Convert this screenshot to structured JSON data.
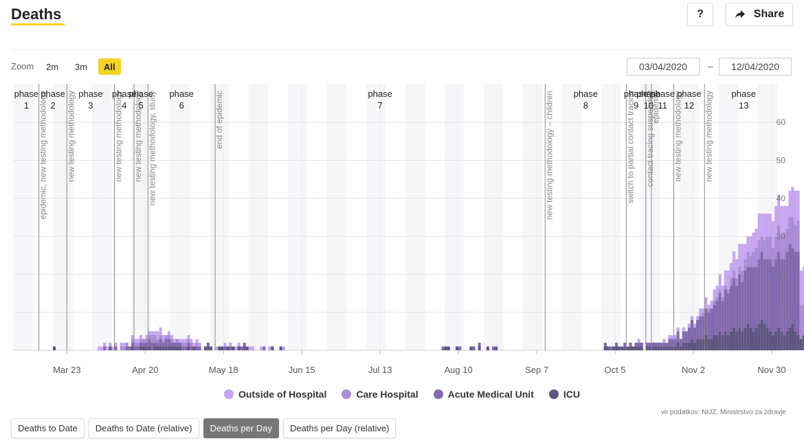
{
  "header": {
    "title": "Deaths",
    "help_label": "?",
    "share_label": "Share"
  },
  "zoom": {
    "label": "Zoom",
    "options": [
      "2m",
      "3m",
      "All"
    ],
    "active": "All"
  },
  "date_range": {
    "from": "03/04/2020",
    "separator": "–",
    "to": "12/04/2020"
  },
  "legend": [
    {
      "label": "Outside of Hospital",
      "color": "#c7a6f0"
    },
    {
      "label": "Care Hospital",
      "color": "#a98bd6"
    },
    {
      "label": "Acute Medical Unit",
      "color": "#8269ad"
    },
    {
      "label": "ICU",
      "color": "#5f5680"
    }
  ],
  "credits": "vir podatkov: NIJZ, Ministrstvo za zdravje",
  "tabs": [
    "Deaths to Date",
    "Deaths to Date (relative)",
    "Deaths per Day",
    "Deaths per Day (relative)"
  ],
  "active_tab": "Deaths per Day",
  "chart_data": {
    "type": "bar",
    "stacked": true,
    "x_start": "2020-03-04",
    "x_end": "2020-12-04",
    "x_ticks": [
      {
        "date": "2020-03-23",
        "label": "Mar 23"
      },
      {
        "date": "2020-04-20",
        "label": "Apr 20"
      },
      {
        "date": "2020-05-18",
        "label": "May 18"
      },
      {
        "date": "2020-06-15",
        "label": "Jun 15"
      },
      {
        "date": "2020-07-13",
        "label": "Jul 13"
      },
      {
        "date": "2020-08-10",
        "label": "Aug 10"
      },
      {
        "date": "2020-09-07",
        "label": "Sep 7"
      },
      {
        "date": "2020-10-05",
        "label": "Oct 5"
      },
      {
        "date": "2020-11-02",
        "label": "Nov 2"
      },
      {
        "date": "2020-11-30",
        "label": "Nov 30"
      }
    ],
    "y_ticks": [
      10,
      20,
      30,
      40,
      50,
      60
    ],
    "ylim": [
      0,
      62
    ],
    "grid": true,
    "phases": [
      {
        "line1": "phase",
        "line2": "1",
        "start": "2020-03-04",
        "end": "2020-03-13"
      },
      {
        "line1": "phase",
        "line2": "2",
        "start": "2020-03-13",
        "end": "2020-03-23"
      },
      {
        "line1": "phase",
        "line2": "3",
        "start": "2020-03-23",
        "end": "2020-04-09"
      },
      {
        "line1": "phase",
        "line2": "4",
        "start": "2020-04-09",
        "end": "2020-04-16"
      },
      {
        "line1": "phase",
        "line2": "5",
        "start": "2020-04-16",
        "end": "2020-04-21"
      },
      {
        "line1": "phase",
        "line2": "6",
        "start": "2020-04-21",
        "end": "2020-05-15"
      },
      {
        "line1": "phase",
        "line2": "7",
        "start": "2020-05-15",
        "end": "2020-09-10"
      },
      {
        "line1": "phase",
        "line2": "8",
        "start": "2020-09-10",
        "end": "2020-10-09"
      },
      {
        "line1": "phase",
        "line2": "9",
        "start": "2020-10-09",
        "end": "2020-10-16"
      },
      {
        "line1": "phase",
        "line2": "10",
        "start": "2020-10-16",
        "end": "2020-10-18"
      },
      {
        "line1": "phase",
        "line2": "11",
        "start": "2020-10-18",
        "end": "2020-10-26"
      },
      {
        "line1": "phase",
        "line2": "12",
        "start": "2020-10-26",
        "end": "2020-11-06"
      },
      {
        "line1": "phase",
        "line2": "13",
        "start": "2020-11-06",
        "end": "2020-12-04"
      }
    ],
    "events": [
      {
        "date": "2020-03-13",
        "label": "epidemic, new testing methodology"
      },
      {
        "date": "2020-03-23",
        "label": "new testing methodology"
      },
      {
        "date": "2020-04-09",
        "label": "new testing methodology"
      },
      {
        "date": "2020-04-16",
        "label": "new testing methodology"
      },
      {
        "date": "2020-04-21",
        "label": "new testing methodology, study"
      },
      {
        "date": "2020-05-15",
        "label": "end of epidemic"
      },
      {
        "date": "2020-09-10",
        "label": "new testing methodology – children"
      },
      {
        "date": "2020-10-09",
        "label": "switch to partial contact tracing"
      },
      {
        "date": "2020-10-16",
        "label": "contact tracing suspended"
      },
      {
        "date": "2020-10-18",
        "label": "epidemic"
      },
      {
        "date": "2020-10-26",
        "label": "new testing methodology"
      },
      {
        "date": "2020-11-06",
        "label": "new testing methodology"
      }
    ],
    "series": [
      {
        "name": "Outside of Hospital",
        "values": [
          0,
          0,
          0,
          0,
          0,
          0,
          0,
          0,
          0,
          0,
          0,
          0,
          0,
          0,
          0,
          0,
          0,
          0,
          0,
          0,
          0,
          0,
          0,
          0,
          0,
          0,
          0,
          0,
          0,
          0,
          1,
          1,
          1,
          1,
          1,
          1,
          1,
          0,
          1,
          1,
          0,
          0,
          1,
          1,
          1,
          1,
          0,
          1,
          1,
          1,
          1,
          2,
          2,
          1,
          0,
          1,
          1,
          1,
          0,
          1,
          1,
          1,
          1,
          1,
          1,
          1,
          1,
          0,
          0,
          0,
          0,
          0,
          1,
          0,
          0,
          1,
          0,
          1,
          0,
          1,
          1,
          0,
          0,
          0,
          1,
          1,
          0,
          0,
          1,
          0,
          0,
          1,
          0,
          0,
          0,
          0,
          1,
          0,
          0,
          0,
          0,
          0,
          0,
          0,
          0,
          0,
          0,
          0,
          0,
          0,
          0,
          0,
          0,
          0,
          0,
          0,
          0,
          0,
          0,
          0,
          0,
          0,
          0,
          0,
          0,
          0,
          0,
          0,
          0,
          0,
          0,
          0,
          0,
          0,
          0,
          0,
          0,
          0,
          0,
          0,
          0,
          0,
          0,
          0,
          0,
          0,
          0,
          0,
          0,
          0,
          0,
          0,
          0,
          0,
          0,
          0,
          0,
          0,
          0,
          0,
          0,
          0,
          0,
          0,
          0,
          0,
          0,
          0,
          0,
          0,
          0,
          0,
          0,
          0,
          0,
          0,
          0,
          0,
          0,
          0,
          0,
          0,
          0,
          0,
          0,
          0,
          0,
          0,
          0,
          0,
          0,
          0,
          0,
          0,
          0,
          0,
          0,
          0,
          0,
          0,
          0,
          0,
          0,
          0,
          0,
          0,
          0,
          0,
          0,
          0,
          0,
          0,
          0,
          0,
          0,
          0,
          0,
          0,
          0,
          0,
          0,
          0,
          0,
          1,
          0,
          0,
          0,
          0,
          0,
          0,
          0,
          0,
          1,
          0,
          1,
          1,
          1,
          1,
          0,
          1,
          0,
          1,
          1,
          1,
          1,
          2,
          1,
          3,
          1,
          2,
          3,
          3,
          4,
          3,
          4,
          5,
          4,
          5,
          5,
          6,
          7,
          4,
          4,
          5,
          5,
          5,
          7,
          6,
          7,
          6,
          6,
          7,
          8,
          8,
          8,
          7,
          6,
          7,
          8,
          9,
          8,
          9,
          10,
          11,
          9,
          10,
          8,
          9,
          10,
          11,
          12
        ]
      },
      {
        "name": "Care Hospital",
        "values": [
          0,
          0,
          0,
          0,
          0,
          0,
          0,
          0,
          0,
          0,
          0,
          0,
          0,
          0,
          0,
          0,
          0,
          0,
          0,
          0,
          0,
          0,
          0,
          0,
          0,
          0,
          0,
          0,
          0,
          0,
          0,
          0,
          0,
          0,
          0,
          0,
          0,
          0,
          1,
          1,
          1,
          0,
          1,
          1,
          1,
          1,
          1,
          1,
          1,
          2,
          2,
          1,
          1,
          1,
          1,
          1,
          1,
          0,
          1,
          0,
          1,
          1,
          1,
          1,
          0,
          1,
          0,
          0,
          0,
          0,
          0,
          0,
          0,
          0,
          0,
          0,
          0,
          0,
          0,
          0,
          0,
          0,
          0,
          0,
          0,
          0,
          0,
          0,
          0,
          0,
          0,
          0,
          0,
          0,
          0,
          0,
          0,
          0,
          0,
          0,
          0,
          0,
          0,
          0,
          0,
          0,
          0,
          0,
          0,
          0,
          0,
          0,
          0,
          0,
          0,
          0,
          0,
          0,
          0,
          0,
          0,
          0,
          0,
          0,
          0,
          0,
          0,
          0,
          0,
          0,
          0,
          0,
          0,
          0,
          0,
          0,
          0,
          0,
          0,
          0,
          0,
          0,
          0,
          0,
          0,
          0,
          0,
          0,
          0,
          0,
          0,
          0,
          0,
          0,
          0,
          0,
          0,
          0,
          0,
          0,
          0,
          0,
          0,
          0,
          0,
          0,
          0,
          0,
          0,
          0,
          0,
          0,
          0,
          0,
          0,
          0,
          0,
          0,
          0,
          0,
          0,
          0,
          0,
          0,
          0,
          0,
          0,
          0,
          0,
          0,
          0,
          0,
          0,
          0,
          0,
          0,
          0,
          0,
          0,
          0,
          0,
          0,
          0,
          0,
          0,
          0,
          0,
          0,
          0,
          0,
          0,
          0,
          0,
          0,
          0,
          0,
          0,
          0,
          0,
          0,
          0,
          0,
          0,
          0,
          0,
          0,
          0,
          0,
          0,
          0,
          0,
          0,
          0,
          0,
          0,
          0,
          0,
          0,
          0,
          0,
          0,
          0,
          0,
          0,
          0,
          0,
          1,
          0,
          1,
          0,
          1,
          1,
          1,
          1,
          1,
          1,
          2,
          2,
          2,
          2,
          3,
          3,
          4,
          3,
          4,
          5,
          5,
          4,
          5,
          6,
          6,
          5,
          6,
          7,
          6,
          7,
          6,
          7,
          8,
          7,
          8,
          9,
          8,
          9,
          8,
          9,
          10,
          9,
          10,
          11,
          12,
          10,
          11,
          12
        ]
      },
      {
        "name": "Acute Medical Unit",
        "values": [
          0,
          0,
          0,
          0,
          0,
          0,
          0,
          0,
          0,
          0,
          0,
          0,
          0,
          0,
          0,
          0,
          0,
          0,
          0,
          0,
          0,
          0,
          0,
          0,
          0,
          0,
          0,
          0,
          0,
          0,
          0,
          0,
          1,
          0,
          0,
          0,
          1,
          0,
          0,
          0,
          1,
          1,
          1,
          1,
          1,
          1,
          1,
          1,
          2,
          2,
          1,
          1,
          2,
          1,
          2,
          2,
          1,
          1,
          1,
          1,
          1,
          1,
          1,
          1,
          0,
          1,
          1,
          0,
          0,
          1,
          0,
          0,
          0,
          0,
          0,
          1,
          0,
          1,
          0,
          0,
          0,
          1,
          1,
          0,
          0,
          0,
          0,
          0,
          0,
          1,
          0,
          0,
          0,
          0,
          0,
          0,
          0,
          0,
          0,
          0,
          0,
          0,
          0,
          0,
          0,
          0,
          0,
          0,
          0,
          0,
          0,
          0,
          0,
          0,
          0,
          0,
          0,
          0,
          0,
          0,
          0,
          0,
          0,
          0,
          0,
          0,
          0,
          0,
          0,
          0,
          0,
          0,
          0,
          0,
          0,
          0,
          0,
          0,
          0,
          0,
          0,
          0,
          0,
          0,
          0,
          0,
          0,
          0,
          0,
          0,
          0,
          0,
          0,
          1,
          0,
          0,
          0,
          0,
          0,
          1,
          0,
          0,
          0,
          0,
          1,
          0,
          1,
          0,
          0,
          0,
          0,
          1,
          0,
          0,
          0,
          0,
          0,
          0,
          0,
          0,
          0,
          0,
          0,
          0,
          0,
          0,
          0,
          0,
          0,
          0,
          0,
          0,
          0,
          0,
          0,
          0,
          0,
          0,
          0,
          0,
          0,
          0,
          0,
          0,
          0,
          0,
          0,
          0,
          0,
          0,
          0,
          1,
          0,
          1,
          0,
          1,
          0,
          0,
          1,
          0,
          1,
          0,
          1,
          1,
          1,
          0,
          1,
          1,
          1,
          1,
          1,
          1,
          1,
          1,
          2,
          2,
          2,
          3,
          2,
          3,
          3,
          4,
          5,
          4,
          5,
          6,
          6,
          7,
          7,
          8,
          8,
          9,
          10,
          9,
          11,
          11,
          12,
          13,
          12,
          14,
          13,
          15,
          15,
          16,
          17,
          16,
          17,
          18,
          17,
          18,
          19,
          18,
          19,
          20,
          19,
          20,
          21,
          22,
          20,
          21,
          22
        ]
      },
      {
        "name": "ICU",
        "values": [
          0,
          0,
          0,
          0,
          0,
          0,
          0,
          0,
          0,
          0,
          0,
          0,
          0,
          0,
          1,
          0,
          0,
          0,
          0,
          0,
          0,
          0,
          0,
          0,
          0,
          0,
          0,
          0,
          0,
          0,
          0,
          0,
          0,
          0,
          1,
          0,
          0,
          0,
          0,
          0,
          0,
          0,
          1,
          0,
          0,
          1,
          1,
          1,
          1,
          0,
          1,
          1,
          1,
          1,
          1,
          1,
          1,
          1,
          1,
          1,
          0,
          0,
          1,
          0,
          1,
          0,
          0,
          0,
          1,
          1,
          1,
          0,
          0,
          1,
          1,
          0,
          1,
          0,
          1,
          0,
          1,
          0,
          1,
          1,
          0,
          0,
          0,
          0,
          0,
          0,
          0,
          0,
          1,
          0,
          0,
          1,
          0,
          0,
          0,
          0,
          0,
          0,
          0,
          0,
          0,
          0,
          0,
          0,
          0,
          0,
          0,
          0,
          0,
          0,
          0,
          0,
          0,
          0,
          0,
          0,
          0,
          0,
          0,
          0,
          0,
          0,
          0,
          0,
          0,
          0,
          0,
          0,
          0,
          0,
          0,
          0,
          0,
          0,
          0,
          0,
          0,
          0,
          0,
          0,
          0,
          0,
          0,
          0,
          0,
          0,
          0,
          0,
          0,
          0,
          1,
          1,
          0,
          0,
          1,
          0,
          0,
          0,
          0,
          1,
          0,
          0,
          1,
          0,
          0,
          1,
          0,
          0,
          1,
          0,
          0,
          0,
          0,
          0,
          0,
          0,
          0,
          0,
          0,
          0,
          0,
          0,
          0,
          0,
          0,
          0,
          0,
          0,
          0,
          0,
          0,
          0,
          0,
          0,
          0,
          0,
          0,
          0,
          0,
          0,
          0,
          0,
          0,
          0,
          0,
          0,
          0,
          1,
          1,
          0,
          1,
          1,
          1,
          1,
          1,
          1,
          1,
          1,
          1,
          1,
          1,
          0,
          1,
          1,
          1,
          1,
          1,
          1,
          1,
          1,
          1,
          1,
          1,
          2,
          1,
          2,
          2,
          2,
          3,
          2,
          3,
          3,
          3,
          4,
          3,
          3,
          4,
          4,
          5,
          4,
          5,
          4,
          5,
          6,
          5,
          6,
          5,
          6,
          7,
          6,
          5,
          6,
          7,
          8,
          7,
          6,
          5,
          4,
          5,
          6,
          5,
          4,
          5,
          6,
          7,
          5,
          4,
          3,
          4
        ]
      }
    ]
  }
}
